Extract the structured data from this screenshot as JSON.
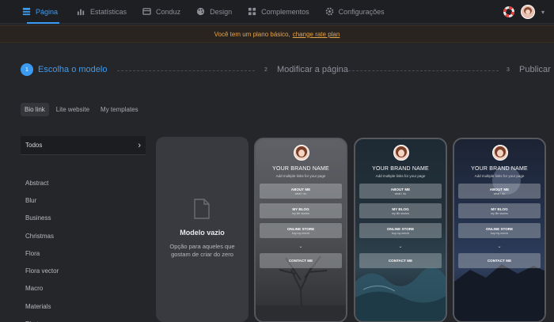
{
  "nav": {
    "items": [
      {
        "label": "Página",
        "icon": "page-icon",
        "active": true
      },
      {
        "label": "Estatísticas",
        "icon": "chart-icon"
      },
      {
        "label": "Conduz",
        "icon": "leads-icon"
      },
      {
        "label": "Design",
        "icon": "palette-icon"
      },
      {
        "label": "Complementos",
        "icon": "addons-icon"
      },
      {
        "label": "Configurações",
        "icon": "gear-icon"
      }
    ],
    "accent": "#3b9bf0"
  },
  "banner": {
    "text": "Você tem um plano básico,",
    "link": "change rate plan",
    "color": "#e5a44a"
  },
  "stepper": {
    "steps": [
      {
        "num": "1",
        "label": "Escolha o modelo",
        "active": true
      },
      {
        "num": "2",
        "label": "Modificar a página"
      },
      {
        "num": "3",
        "label": "Publicar"
      }
    ]
  },
  "tabs": [
    {
      "label": "Bio link",
      "active": true
    },
    {
      "label": "Lite website"
    },
    {
      "label": "My templates"
    }
  ],
  "categories": {
    "all": "Todos",
    "items": [
      "Abstract",
      "Blur",
      "Business",
      "Christmas",
      "Flora",
      "Flora vector",
      "Macro",
      "Materials",
      "Photos"
    ]
  },
  "empty_template": {
    "title": "Modelo vazio",
    "desc": "Opção para aqueles que gostam de criar do zero"
  },
  "templates": [
    {
      "brand": "YOUR BRAND NAME",
      "sub": "Add multiple links for your page",
      "buttons": [
        {
          "label": "ABOUT ME",
          "sub": "what I do"
        },
        {
          "label": "MY BLOG",
          "sub": "my life stories"
        },
        {
          "label": "ONLINE STORE",
          "sub": "buy my merch"
        }
      ],
      "contact": "CONTACT ME"
    },
    {
      "brand": "YOUR BRAND NAME",
      "sub": "Add multiple links for your page",
      "buttons": [
        {
          "label": "ABOUT ME",
          "sub": "what I do"
        },
        {
          "label": "MY BLOG",
          "sub": "my life stories"
        },
        {
          "label": "ONLINE STORE",
          "sub": "buy my merch"
        }
      ],
      "contact": "CONTACT ME"
    },
    {
      "brand": "YOUR BRAND NAME",
      "sub": "Add multiple links for your page",
      "buttons": [
        {
          "label": "ABOUT ME",
          "sub": "what I do"
        },
        {
          "label": "MY BLOG",
          "sub": "my life stories"
        },
        {
          "label": "ONLINE STORE",
          "sub": "buy my merch"
        }
      ],
      "contact": "CONTACT ME"
    }
  ]
}
